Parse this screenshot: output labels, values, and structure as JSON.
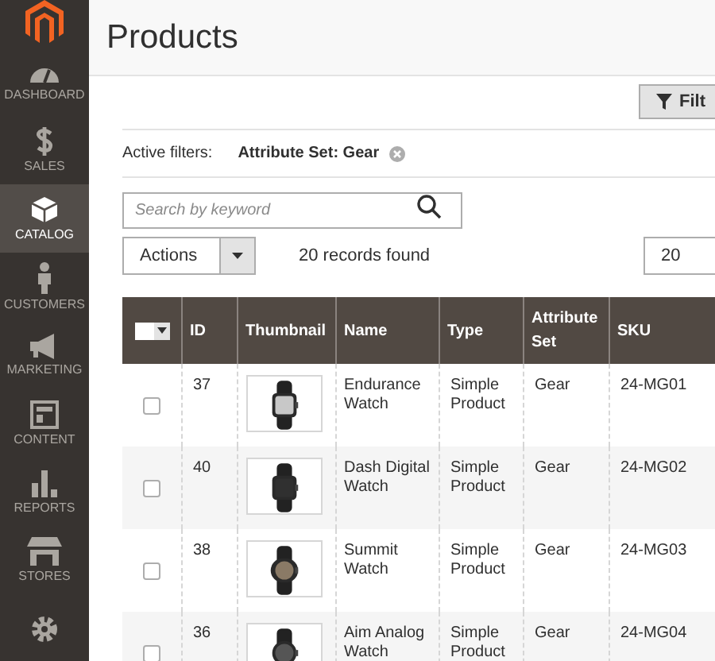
{
  "sidebar": {
    "items": [
      {
        "kind": "dashboard",
        "label": "DASHBOARD",
        "selected": false
      },
      {
        "kind": "sales",
        "label": "SALES",
        "selected": false
      },
      {
        "kind": "catalog",
        "label": "CATALOG",
        "selected": true
      },
      {
        "kind": "customers",
        "label": "CUSTOMERS",
        "selected": false
      },
      {
        "kind": "marketing",
        "label": "MARKETING",
        "selected": false
      },
      {
        "kind": "content",
        "label": "CONTENT",
        "selected": false
      },
      {
        "kind": "reports",
        "label": "REPORTS",
        "selected": false
      },
      {
        "kind": "stores",
        "label": "STORES",
        "selected": false
      },
      {
        "kind": "settings",
        "selected": false
      }
    ]
  },
  "page_title": "Products",
  "filters_button": "Filt",
  "active_filters": {
    "label": "Active filters:",
    "filters": [
      "Attribute Set: Gear"
    ]
  },
  "search": {
    "placeholder": "Search by keyword"
  },
  "actions": "Actions",
  "records_found": "20 records found",
  "page_size": "20",
  "table": {
    "columns": [
      "ID",
      "Thumbnail",
      "Name",
      "Type",
      "Attribute Set",
      "SKU"
    ],
    "rows": [
      {
        "checked": false,
        "id": "37",
        "name": "Endurance Watch",
        "type": "Simple Product",
        "attribute_set": "Gear",
        "sku": "24-MG01"
      },
      {
        "checked": false,
        "id": "40",
        "name": "Dash Digital Watch",
        "type": "Simple Product",
        "attribute_set": "Gear",
        "sku": "24-MG02"
      },
      {
        "checked": false,
        "id": "38",
        "name": "Summit Watch",
        "type": "Simple Product",
        "attribute_set": "Gear",
        "sku": "24-MG03"
      },
      {
        "checked": false,
        "id": "36",
        "name": "Aim Analog Watch",
        "type": "Simple Product",
        "attribute_set": "Gear",
        "sku": "24-MG04"
      }
    ]
  }
}
